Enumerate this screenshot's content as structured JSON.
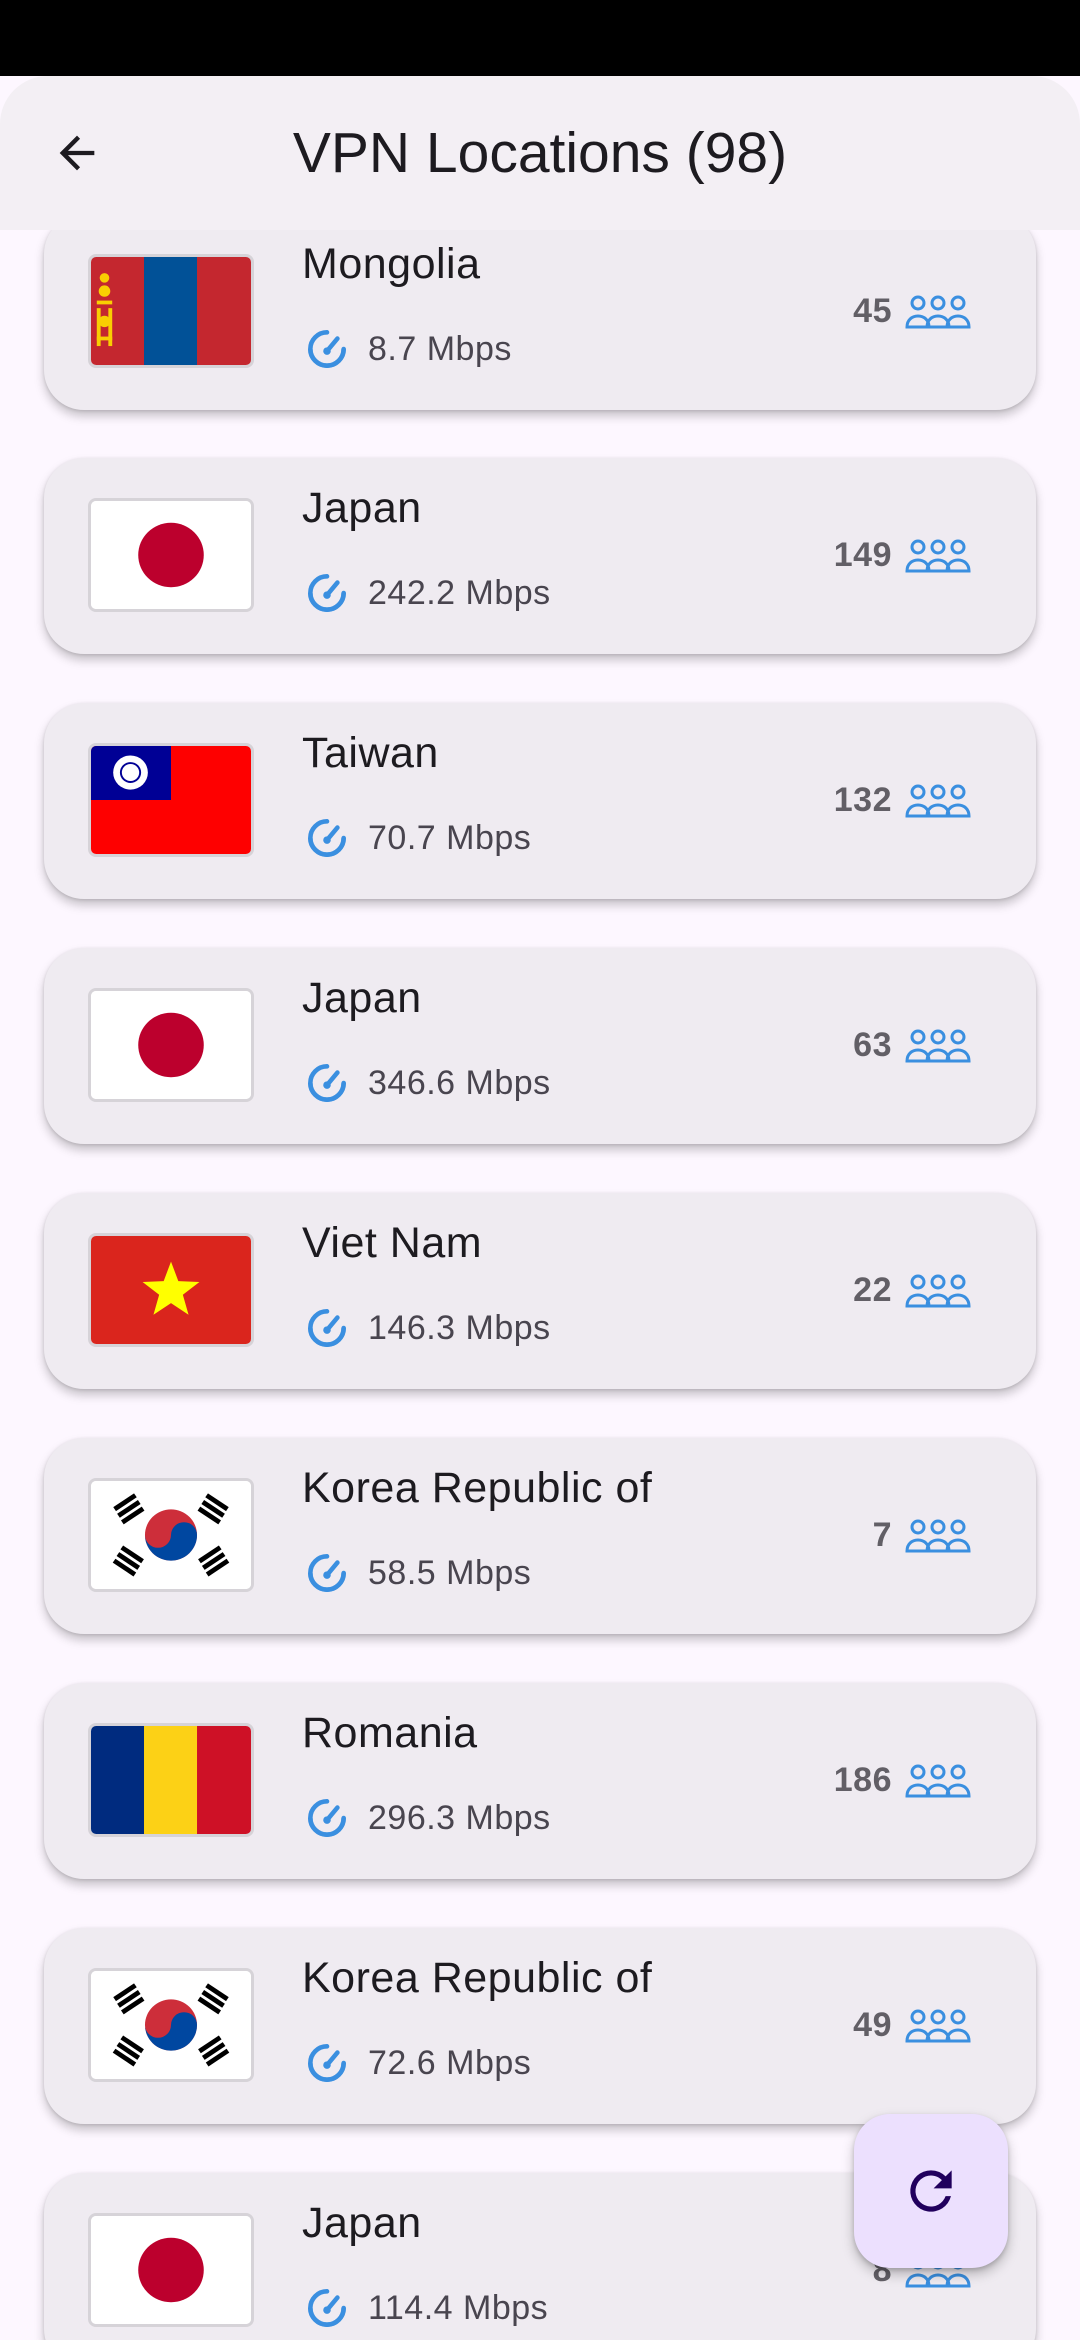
{
  "header": {
    "title": "VPN Locations (98)",
    "back_icon": "arrow-back-icon"
  },
  "colors": {
    "accent_blue": "#3a8fe0",
    "card_bg": "#efebf1",
    "fab_bg": "#ece0fe"
  },
  "locations": [
    {
      "country": "Mongolia",
      "flag": "mongolia",
      "speed": "8.7 Mbps",
      "users": "45"
    },
    {
      "country": "Japan",
      "flag": "japan",
      "speed": "242.2 Mbps",
      "users": "149"
    },
    {
      "country": "Taiwan",
      "flag": "taiwan",
      "speed": "70.7 Mbps",
      "users": "132"
    },
    {
      "country": "Japan",
      "flag": "japan",
      "speed": "346.6 Mbps",
      "users": "63"
    },
    {
      "country": "Viet Nam",
      "flag": "vietnam",
      "speed": "146.3 Mbps",
      "users": "22"
    },
    {
      "country": "Korea Republic of",
      "flag": "korea",
      "speed": "58.5 Mbps",
      "users": "7"
    },
    {
      "country": "Romania",
      "flag": "romania",
      "speed": "296.3 Mbps",
      "users": "186"
    },
    {
      "country": "Korea Republic of",
      "flag": "korea",
      "speed": "72.6 Mbps",
      "users": "49"
    },
    {
      "country": "Japan",
      "flag": "japan",
      "speed": "114.4 Mbps",
      "users": "8"
    }
  ],
  "fab": {
    "icon": "refresh-icon"
  }
}
